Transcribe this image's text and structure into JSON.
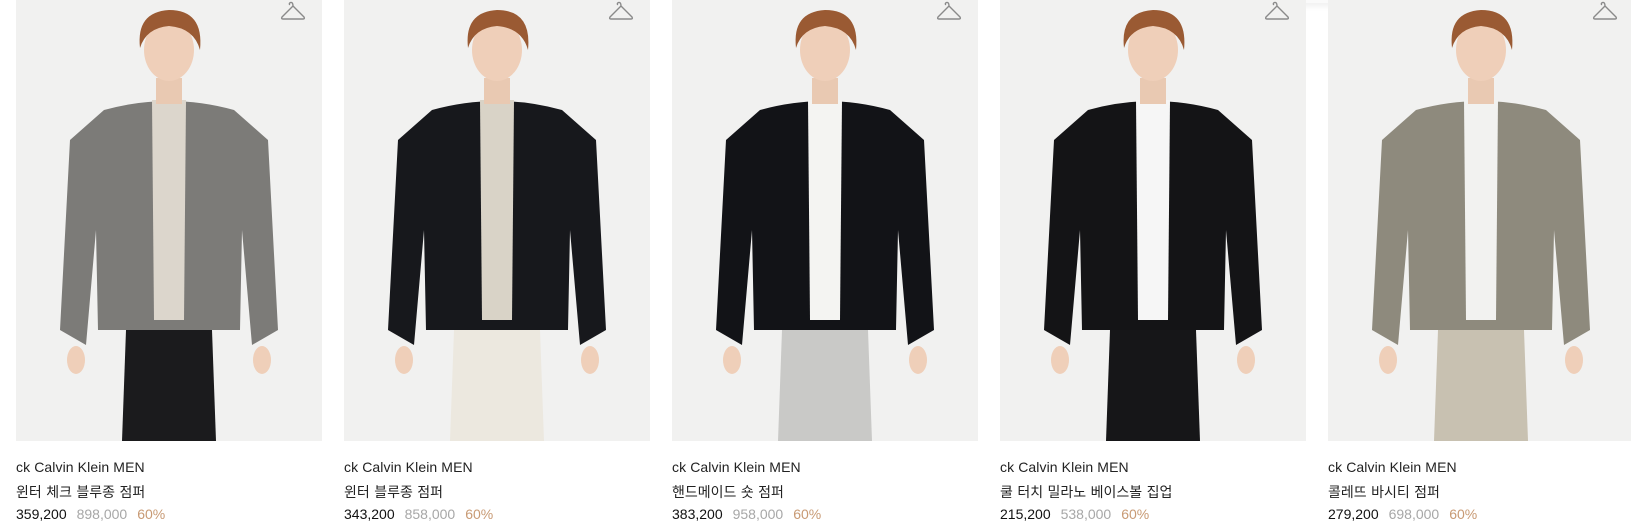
{
  "products": [
    {
      "brand": "ck Calvin Klein MEN",
      "name": "윈터 체크 블루종 점퍼",
      "sale_price": "359,200",
      "original_price": "898,000",
      "discount": "60%",
      "jacket_color": "#7c7b78",
      "pants_color": "#1b1b1d",
      "inner_color": "#dcd6cc"
    },
    {
      "brand": "ck Calvin Klein MEN",
      "name": "윈터 블루종 점퍼",
      "sale_price": "343,200",
      "original_price": "858,000",
      "discount": "60%",
      "jacket_color": "#17181c",
      "pants_color": "#ece8df",
      "inner_color": "#d9d3c7"
    },
    {
      "brand": "ck Calvin Klein MEN",
      "name": "핸드메이드 숏 점퍼",
      "sale_price": "383,200",
      "original_price": "958,000",
      "discount": "60%",
      "jacket_color": "#121317",
      "pants_color": "#c9c9c7",
      "inner_color": "#f4f4f2"
    },
    {
      "brand": "ck Calvin Klein MEN",
      "name": "쿨 터치 밀라노 베이스볼 집업",
      "sale_price": "215,200",
      "original_price": "538,000",
      "discount": "60%",
      "jacket_color": "#141416",
      "pants_color": "#161618",
      "inner_color": "#f6f6f6"
    },
    {
      "brand": "ck Calvin Klein MEN",
      "name": "콜레뜨 바시티 점퍼",
      "sale_price": "279,200",
      "original_price": "698,000",
      "discount": "60%",
      "jacket_color": "#8e8a7d",
      "pants_color": "#c8c1b1",
      "inner_color": "#f2f2f0"
    }
  ],
  "icons": {
    "wishlist": "hanger-icon"
  }
}
